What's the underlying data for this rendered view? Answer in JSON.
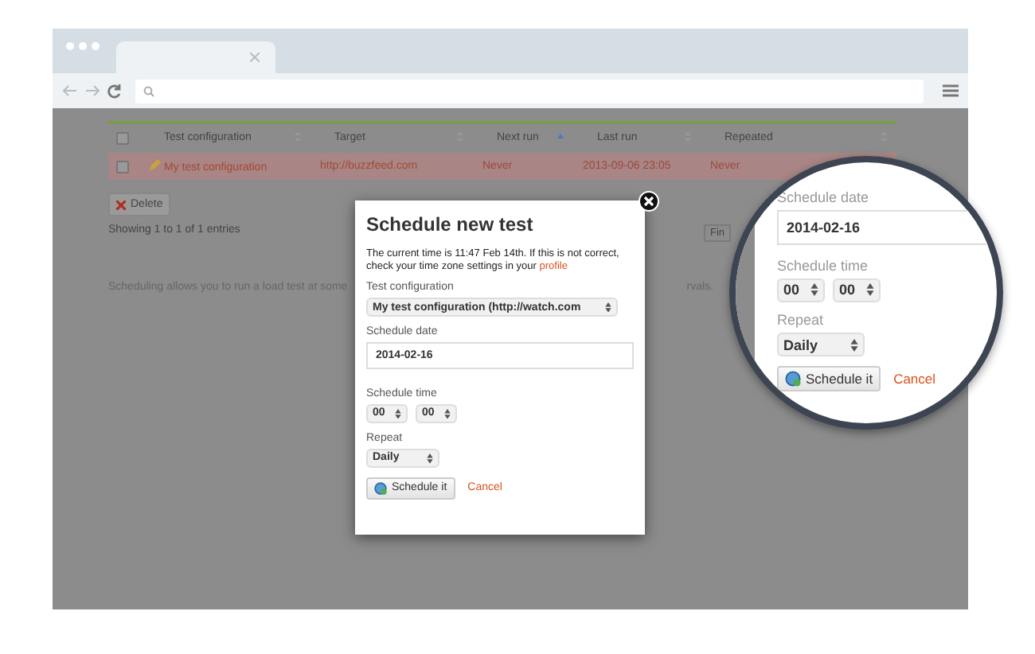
{
  "table": {
    "all_checked": false,
    "columns": [
      {
        "label": "Test configuration",
        "sorted": false
      },
      {
        "label": "Target",
        "sorted": false
      },
      {
        "label": "Next run",
        "sorted": true
      },
      {
        "label": "Last run",
        "sorted": false
      },
      {
        "label": "Repeated",
        "sorted": false
      }
    ],
    "rows": [
      {
        "checked": false,
        "cells": [
          "My test configuration",
          "http://buzzfeed.com",
          "Never",
          "2013-09-06 23:05",
          "Never"
        ]
      }
    ]
  },
  "delete_button": "Delete",
  "entries_info": "Showing 1 to 1 of 1 entries",
  "filter_stub": "Fin",
  "description_left": "Scheduling allows you to run a load test at some",
  "description_right": "rvals.",
  "modal": {
    "title": "Schedule new test",
    "message": "The current time is 11:47 Feb 14th. If this is not correct, check your time zone settings in your",
    "message_link": "profile",
    "config_label": "Test configuration",
    "config_value": "My test configuration (http://watch.com",
    "date_label": "Schedule date",
    "date_value": "2014-02-16",
    "time_label": "Schedule time",
    "hour": "00",
    "minute": "00",
    "repeat_label": "Repeat",
    "repeat_value": "Daily",
    "submit": "Schedule it",
    "cancel": "Cancel"
  },
  "magnifier": {
    "date_label": "Schedule date",
    "date_value": "2014-02-16",
    "time_label": "Schedule time",
    "hour": "00",
    "minute": "00",
    "repeat_label": "Repeat",
    "repeat_value": "Daily",
    "submit": "Schedule it",
    "cancel": "Cancel"
  }
}
